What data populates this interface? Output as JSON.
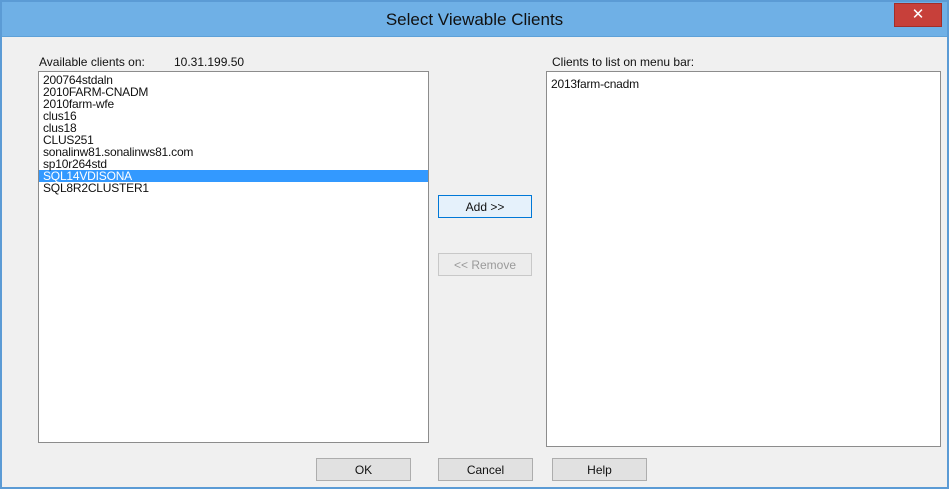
{
  "window": {
    "title": "Select Viewable Clients",
    "close_glyph": "✕"
  },
  "available": {
    "label": "Available clients on:",
    "host": "10.31.199.50",
    "items": [
      "200764stdaln",
      "2010FARM-CNADM",
      "2010farm-wfe",
      "clus16",
      "clus18",
      "CLUS251",
      "sonalinw81.sonalinws81.com",
      "sp10r264std",
      "SQL14VDISONA",
      "SQL8R2CLUSTER1"
    ],
    "selected_index": 8
  },
  "menubar_clients": {
    "label": "Clients to list on menu bar:",
    "items": [
      "2013farm-cnadm"
    ]
  },
  "buttons": {
    "add": "Add >>",
    "remove": "<< Remove",
    "ok": "OK",
    "cancel": "Cancel",
    "help": "Help"
  },
  "colors": {
    "titlebar": "#6fb0e6",
    "selection": "#3399ff",
    "close": "#c7403a"
  }
}
